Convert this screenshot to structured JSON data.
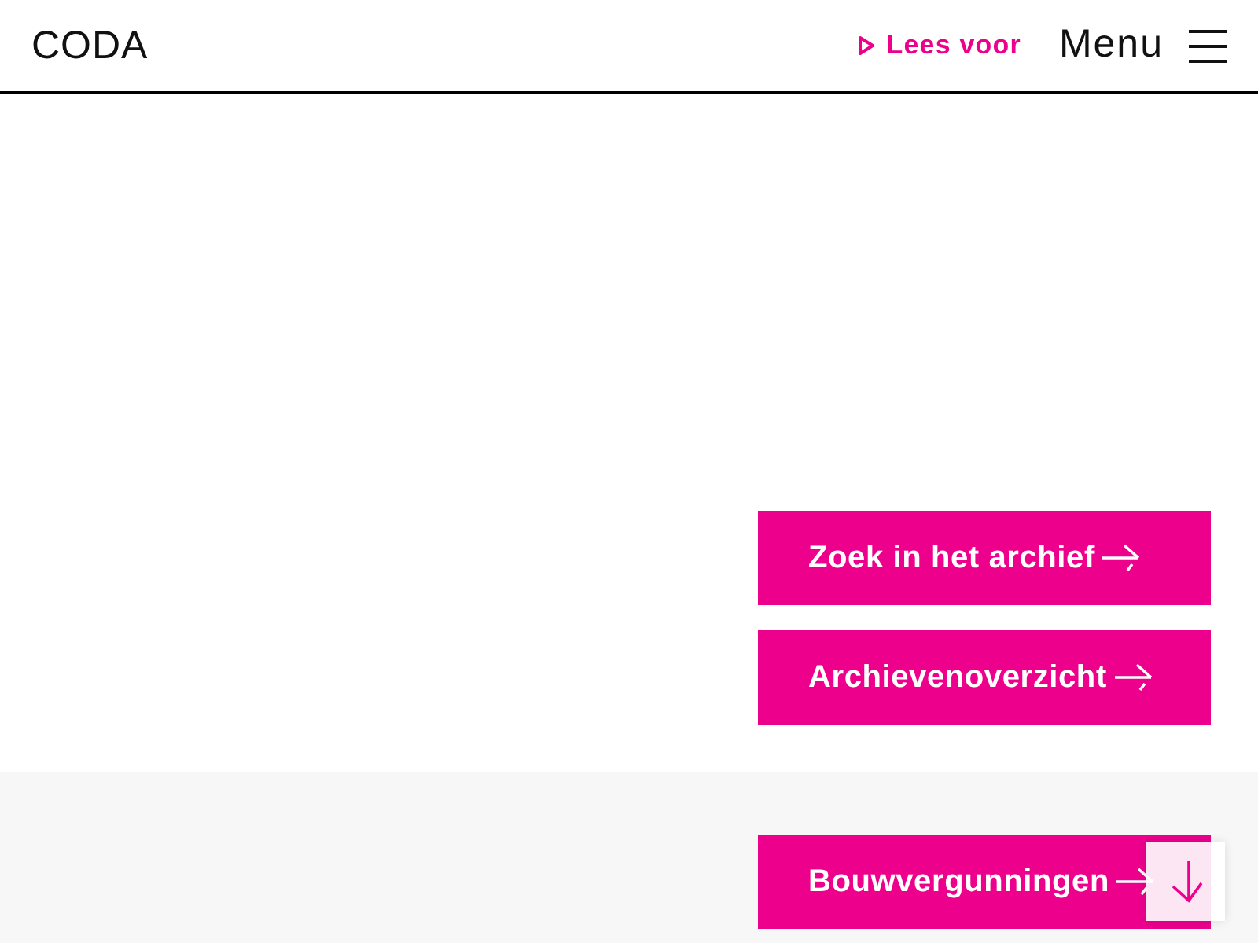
{
  "header": {
    "logo": "CODA",
    "read_aloud": {
      "label": "Lees voor"
    },
    "menu": {
      "label": "Menu"
    }
  },
  "links": [
    {
      "label": "Zoek in het archief"
    },
    {
      "label": "Archievenoverzicht"
    }
  ],
  "section": {
    "links": [
      {
        "label": "Bouwvergunningen"
      }
    ]
  }
}
